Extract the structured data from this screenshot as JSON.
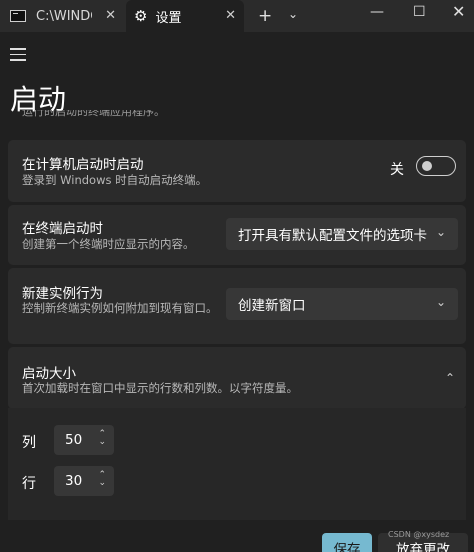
{
  "tabs": [
    {
      "label": "C:\\WINDO",
      "icon": "terminal-icon"
    },
    {
      "label": "设置",
      "icon": "gear-icon",
      "active": true
    }
  ],
  "page": {
    "title": "启动",
    "clipped_text": "运行的启动的终端应用程序。"
  },
  "settings": {
    "launch_on_startup": {
      "title": "在计算机启动时启动",
      "desc": "登录到 Windows 时自动启动终端。",
      "state_label": "关"
    },
    "on_launch": {
      "title": "在终端启动时",
      "desc": "创建第一个终端时应显示的内容。",
      "value": "打开具有默认配置文件的选项卡"
    },
    "new_instance": {
      "title": "新建实例行为",
      "desc": "控制新终端实例如何附加到现有窗口。",
      "value": "创建新窗口"
    },
    "launch_size": {
      "title": "启动大小",
      "desc": "首次加载时在窗口中显示的行数和列数。以字符度量。",
      "columns_label": "列",
      "columns_value": "50",
      "rows_label": "行",
      "rows_value": "30"
    }
  },
  "footer": {
    "save_label": "保存",
    "discard_label": "放弃更改",
    "watermark": "CSDN @xysdez"
  }
}
